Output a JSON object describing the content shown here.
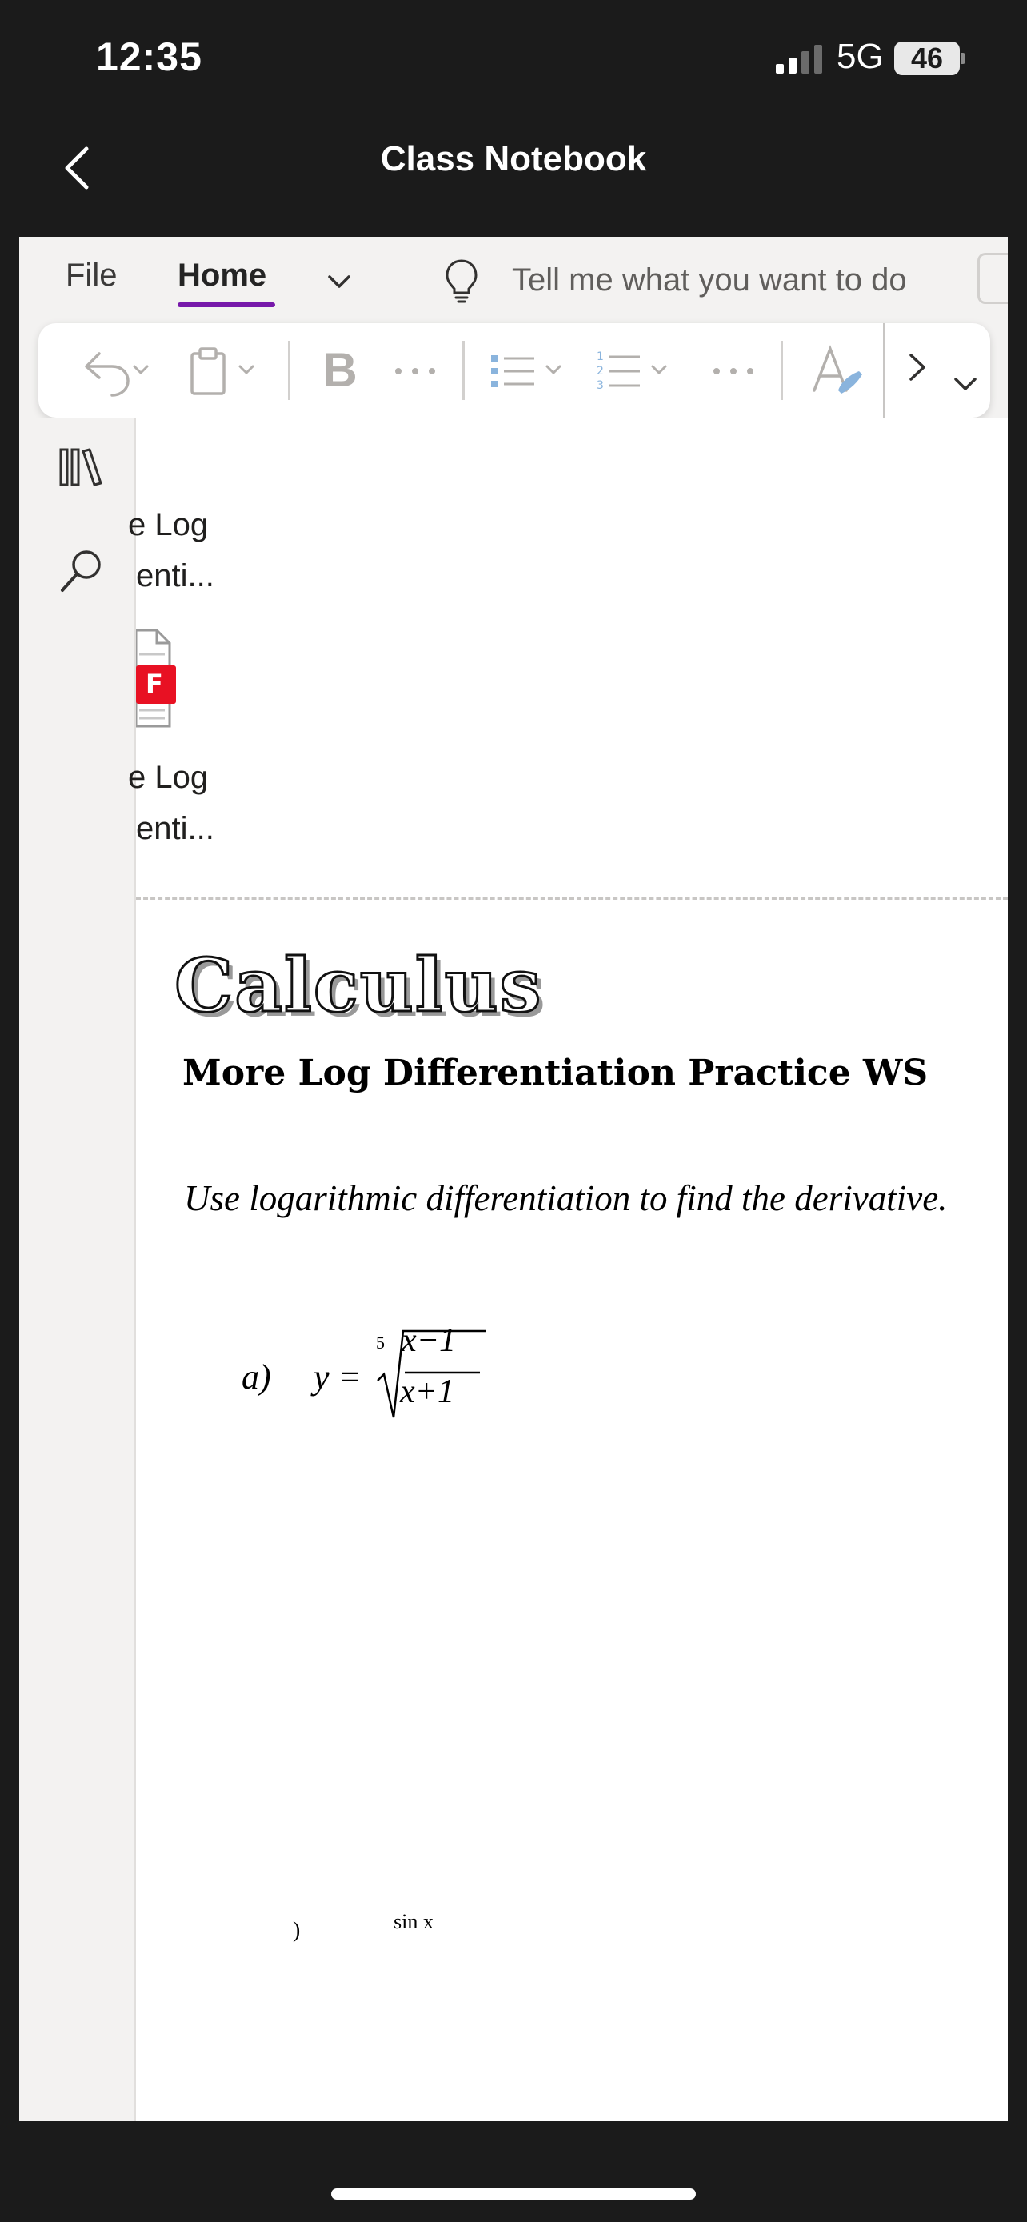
{
  "status_bar": {
    "time": "12:35",
    "network": "5G",
    "battery": "46"
  },
  "nav": {
    "title": "Class Notebook"
  },
  "menu": {
    "tabs": [
      "File",
      "Home"
    ],
    "active_tab": "Home",
    "search_placeholder": "Tell me what you want to do",
    "accent_color": "#7719aa"
  },
  "ribbon": {
    "items": [
      "undo-icon",
      "paste-icon",
      "bold-icon",
      "more-icon",
      "bullets-icon",
      "numbering-icon",
      "more-icon",
      "styles-icon",
      "chevron-right-icon",
      "chevron-down-icon"
    ],
    "bold_label": "B"
  },
  "sidebar": {
    "icons": [
      "notebooks-icon",
      "search-icon"
    ]
  },
  "page_list": {
    "items": [
      {
        "line1": "e Log",
        "line2": "enti..."
      },
      {
        "line1": "e Log",
        "line2": "enti..."
      }
    ],
    "pdf_label": "F"
  },
  "document": {
    "title": "Calculus",
    "subtitle": "More Log Differentiation Practice WS",
    "instructions": "Use logarithmic differentiation to find the derivative.",
    "problem_a": {
      "label": "a)",
      "lhs": "y =",
      "root_index": "5",
      "numerator": "x−1",
      "denominator": "x+1"
    },
    "next_problem_fragment": "sin x"
  }
}
